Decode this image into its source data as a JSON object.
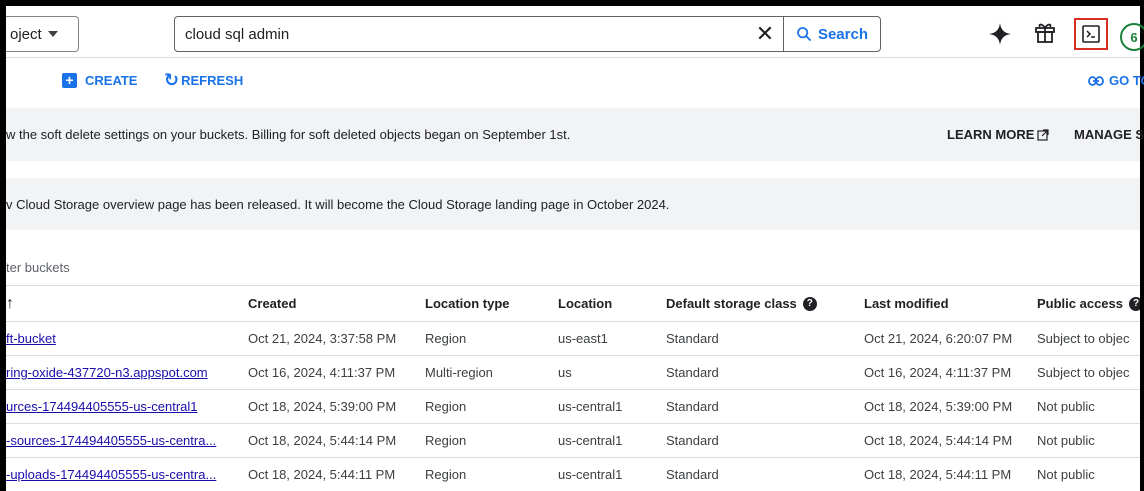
{
  "topbar": {
    "project_label": "oject",
    "search_value": "cloud sql admin",
    "clear_label": "✕",
    "search_button_label": "Search",
    "notification_count": "6"
  },
  "actions": {
    "create_label": "CREATE",
    "refresh_label": "REFRESH",
    "goto_label": "GO TO"
  },
  "banners": {
    "soft_delete": "w the soft delete settings on your buckets. Billing for soft deleted objects began on September 1st.",
    "learn_more": "LEARN MORE",
    "manage": "MANAGE S",
    "overview": "v Cloud Storage overview page has been released. It will become the Cloud Storage landing page in October 2024."
  },
  "filter": {
    "label": "ter buckets"
  },
  "table": {
    "columns": {
      "name": "↑",
      "created": "Created",
      "location_type": "Location type",
      "location": "Location",
      "storage_class": "Default storage class",
      "last_modified": "Last modified",
      "public_access": "Public access"
    },
    "rows": [
      {
        "name": "ft-bucket",
        "created": "Oct 21, 2024, 3:37:58 PM",
        "location_type": "Region",
        "location": "us-east1",
        "storage_class": "Standard",
        "last_modified": "Oct 21, 2024, 6:20:07 PM",
        "public_access": "Subject to objec"
      },
      {
        "name": "ring-oxide-437720-n3.appspot.com",
        "created": "Oct 16, 2024, 4:11:37 PM",
        "location_type": "Multi-region",
        "location": "us",
        "storage_class": "Standard",
        "last_modified": "Oct 16, 2024, 4:11:37 PM",
        "public_access": "Subject to objec"
      },
      {
        "name": "urces-174494405555-us-central1",
        "created": "Oct 18, 2024, 5:39:00 PM",
        "location_type": "Region",
        "location": "us-central1",
        "storage_class": "Standard",
        "last_modified": "Oct 18, 2024, 5:39:00 PM",
        "public_access": "Not public"
      },
      {
        "name": "-sources-174494405555-us-centra...",
        "created": "Oct 18, 2024, 5:44:14 PM",
        "location_type": "Region",
        "location": "us-central1",
        "storage_class": "Standard",
        "last_modified": "Oct 18, 2024, 5:44:14 PM",
        "public_access": "Not public"
      },
      {
        "name": "-uploads-174494405555-us-centra...",
        "created": "Oct 18, 2024, 5:44:11 PM",
        "location_type": "Region",
        "location": "us-central1",
        "storage_class": "Standard",
        "last_modified": "Oct 18, 2024, 5:44:11 PM",
        "public_access": "Not public"
      }
    ]
  },
  "colors": {
    "accent": "#1a73e8",
    "banner_bg": "#f1f3f4",
    "highlight_border": "#d93025",
    "notification": "#188038"
  },
  "icons": [
    "caret-down-icon",
    "close-icon",
    "search-icon",
    "gemini-sparkle-icon",
    "gift-icon",
    "cloud-shell-icon",
    "plus-icon",
    "refresh-icon",
    "link-icon",
    "external-link-icon",
    "sort-arrow-up-icon",
    "help-icon"
  ]
}
